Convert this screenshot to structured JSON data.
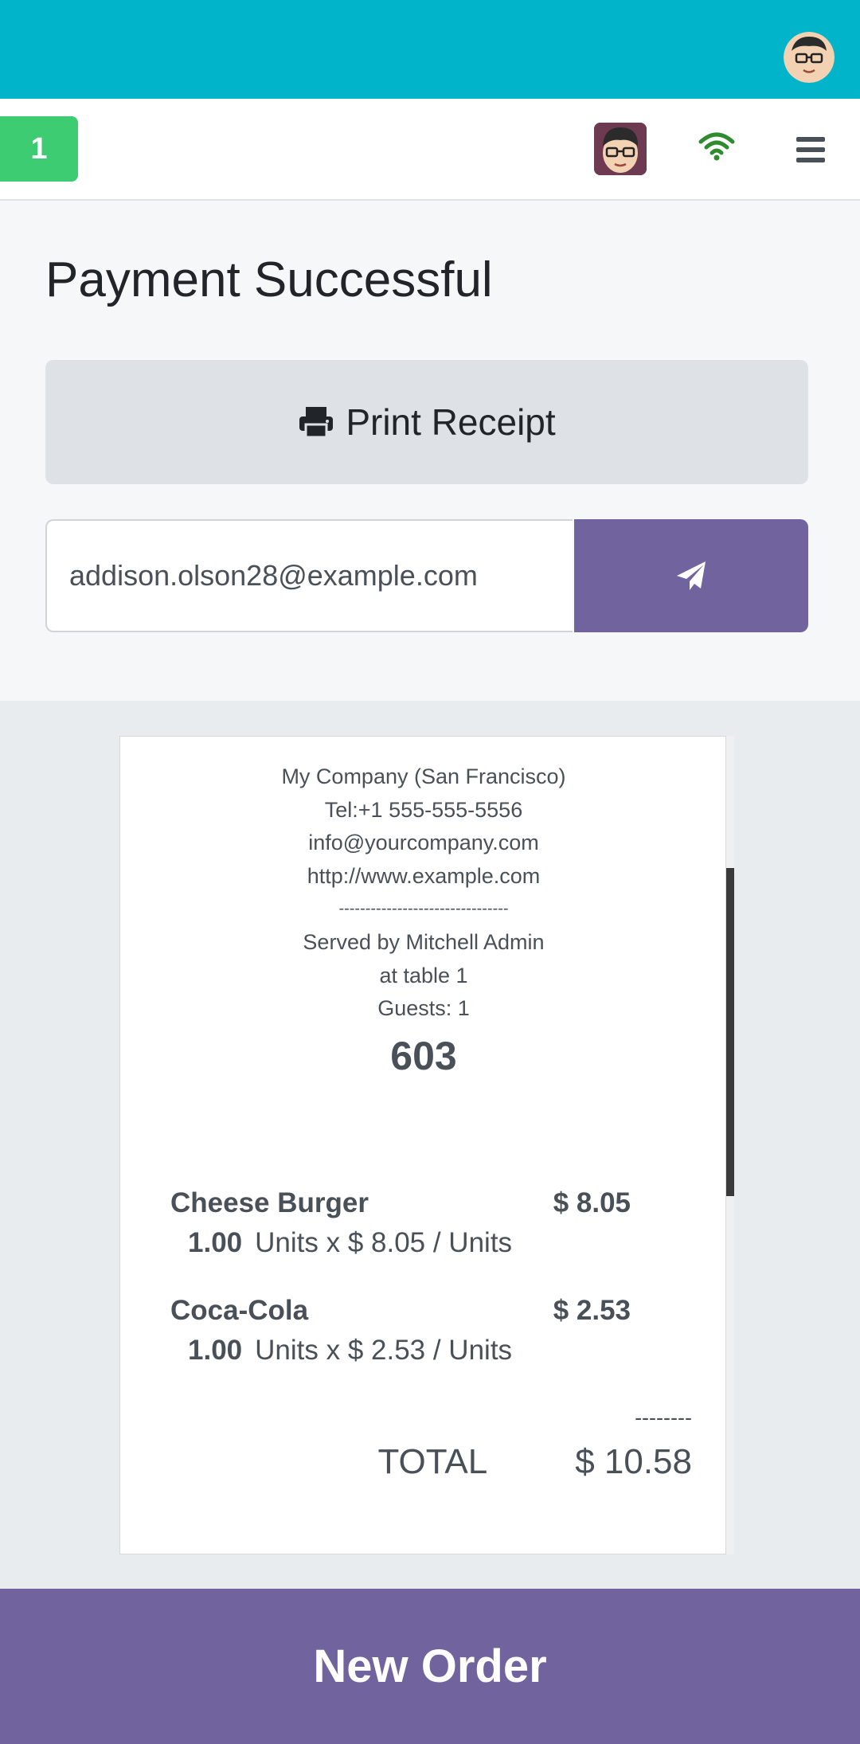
{
  "app": {
    "accent_color": "#01b4c9",
    "primary_color": "#71639e"
  },
  "header": {
    "user_avatar_icon": "user-avatar-face"
  },
  "pos_bar": {
    "table_number": "1",
    "cashier_avatar_icon": "cashier-avatar-face",
    "connection_icon": "wifi-icon",
    "menu_icon": "hamburger-menu-icon"
  },
  "payment": {
    "title": "Payment Successful",
    "print_receipt_label": "Print Receipt",
    "email_value": "addison.olson28@example.com",
    "send_icon": "paper-plane-icon"
  },
  "receipt": {
    "company": "My Company (San Francisco)",
    "phone": "Tel:+1 555-555-5556",
    "email": "info@yourcompany.com",
    "website": "http://www.example.com",
    "separator": "--------------------------------",
    "served_by": "Served by Mitchell Admin",
    "table": "at table 1",
    "guests": "Guests: 1",
    "order_number": "603",
    "lines": [
      {
        "product": "Cheese Burger",
        "price": "$ 8.05",
        "qty": "1.00",
        "unit_detail": "Units x $ 8.05 / Units"
      },
      {
        "product": "Coca-Cola",
        "price": "$ 2.53",
        "qty": "1.00",
        "unit_detail": "Units x $ 2.53 / Units"
      }
    ],
    "total_separator": "--------",
    "total_label": "TOTAL",
    "total_value": "$ 10.58"
  },
  "footer": {
    "new_order_label": "New Order"
  }
}
